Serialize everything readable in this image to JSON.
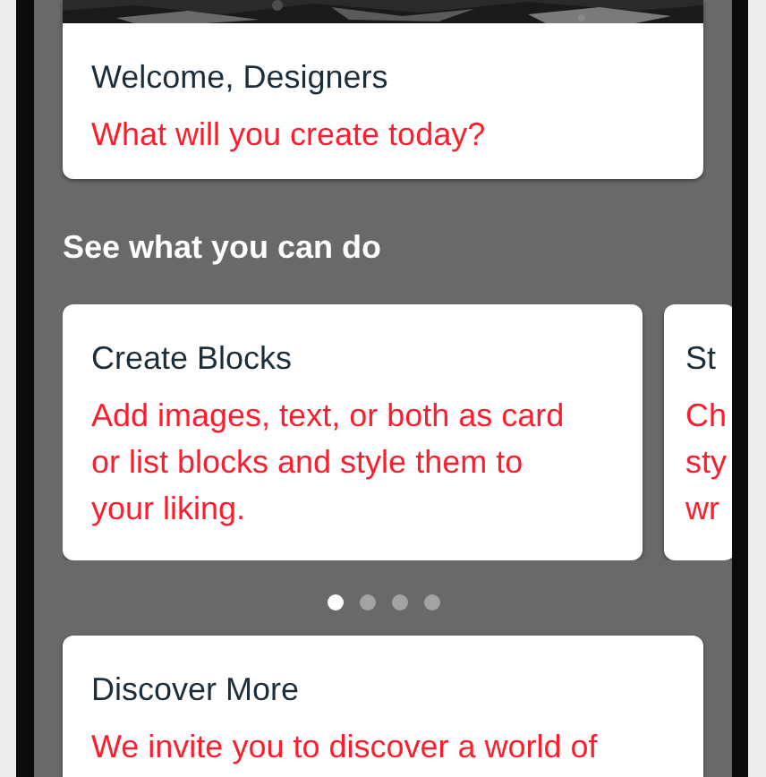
{
  "hero": {
    "kind": "picture",
    "title": "Welcome, Designers",
    "subtitle": "What will you create today?"
  },
  "section_title": "See what you can do",
  "carousel": {
    "cards": [
      {
        "title": "Create Blocks",
        "lines": [
          "Add images, text, or both as card",
          "or list blocks and style them to",
          "your liking."
        ]
      },
      {
        "title": "St",
        "lines": [
          "Ch",
          "sty",
          "wr"
        ]
      }
    ],
    "pages": [
      {
        "selected": true
      },
      {
        "selected": false
      },
      {
        "selected": false
      },
      {
        "selected": false
      }
    ]
  },
  "discover": {
    "title": "Discover More",
    "lines": [
      "We invite you to discover a world of"
    ]
  }
}
